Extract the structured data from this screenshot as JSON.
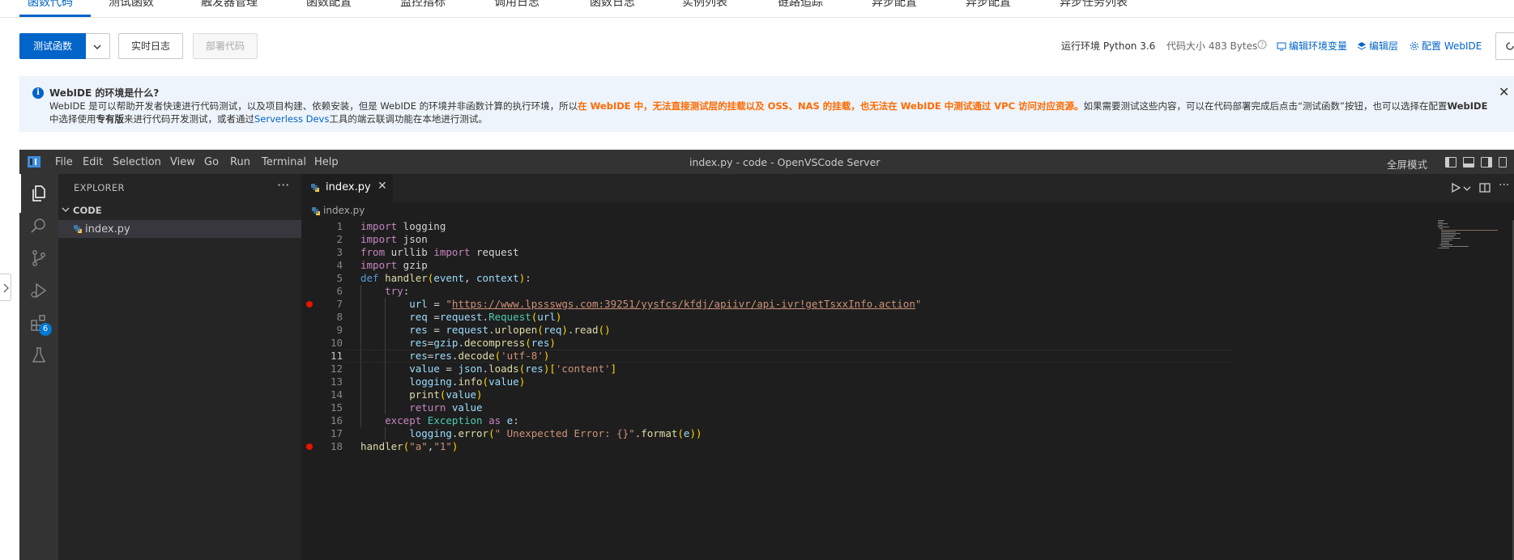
{
  "tabs": [
    {
      "label": "函数代码",
      "active": true
    },
    {
      "label": "测试函数"
    },
    {
      "label": "触发器管理"
    },
    {
      "label": "函数配置"
    },
    {
      "label": "监控指标"
    },
    {
      "label": "调用日志"
    },
    {
      "label": "函数日志"
    },
    {
      "label": "实例列表"
    },
    {
      "label": "链路追踪"
    },
    {
      "label": "异步配置"
    },
    {
      "label": "异步配置"
    },
    {
      "label": "异步任务列表"
    }
  ],
  "toolbar": {
    "test_label": "测试函数",
    "realtime_log_label": "实时日志",
    "deploy_label": "部署代码",
    "runtime": "运行环境 Python 3.6",
    "code_size": "代码大小 483 Bytes",
    "env_vars_label": "编辑环境变量",
    "layer_label": "编辑层",
    "webide_label": "配置 WebIDE"
  },
  "banner": {
    "title": "WebIDE 的环境是什么?",
    "line1_a": "WebIDE 是可以帮助开发者快速进行代码测试，以及项目构建、依赖安装，但是 WebIDE 的环境并非函数计算的执行环境，所以",
    "line1_b": "在 WebIDE 中，无法直接测试层的挂载以及 OSS、NAS 的挂载，也无法在 WebIDE 中测试通过 VPC 访问对应资源。",
    "line1_c": "如果需要测试这些内容，可以在代码部署完成后点击“测试函数”按钮，也可以选择在配置",
    "line1_d": "WebIDE",
    "line2_a": "中选择使用",
    "line2_b": "专有版",
    "line2_c": "来进行代码开发测试，或者通过",
    "line2_d": "Serverless Devs",
    "line2_e": "工具的端云联调功能在本地进行测试。"
  },
  "ide": {
    "menus": [
      "File",
      "Edit",
      "Selection",
      "View",
      "Go",
      "Run",
      "Terminal",
      "Help"
    ],
    "window_title": "index.py - code - OpenVSCode Server",
    "fullscreen_label": "全屏模式",
    "extensions_badge": "6",
    "explorer_title": "EXPLORER",
    "explorer_more": "···",
    "folder_name": "CODE",
    "file_name": "index.py",
    "tab_name": "index.py",
    "tab_close": "✕",
    "breadcrumb": "index.py",
    "current_line": 11,
    "breakpoints": [
      7,
      18
    ],
    "line_numbers": [
      "1",
      "2",
      "3",
      "4",
      "5",
      "6",
      "7",
      "8",
      "9",
      "10",
      "11",
      "12",
      "13",
      "14",
      "15",
      "16",
      "17",
      "18"
    ]
  },
  "colors": {
    "primary": "#0064c8",
    "warning": "#ff6a00",
    "editor_bg": "#1e1e1e",
    "breakpoint": "#e51400"
  }
}
